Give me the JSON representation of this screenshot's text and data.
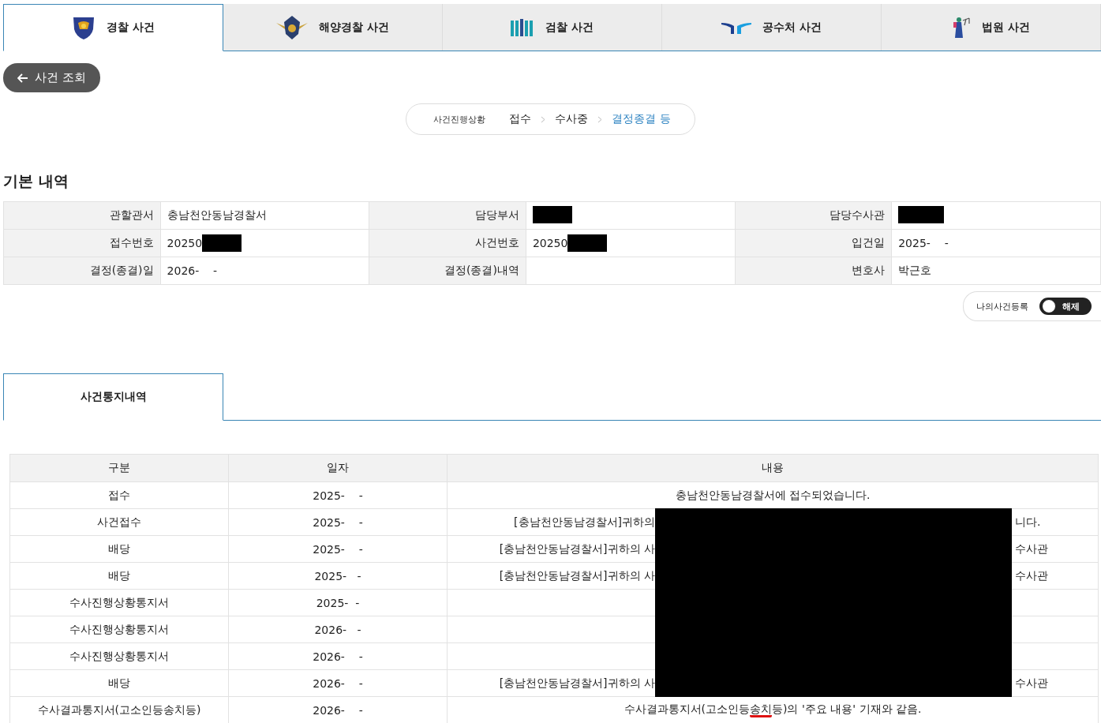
{
  "agency_tabs": [
    {
      "label": "경찰 사건",
      "kind": "police",
      "selected": true
    },
    {
      "label": "해양경찰 사건",
      "kind": "coastguard",
      "selected": false
    },
    {
      "label": "검찰 사건",
      "kind": "prosecution",
      "selected": false
    },
    {
      "label": "공수처 사건",
      "kind": "cio",
      "selected": false
    },
    {
      "label": "법원 사건",
      "kind": "court",
      "selected": false
    }
  ],
  "back_button": {
    "label": "사건 조회"
  },
  "progress": {
    "label": "사건진행상황",
    "steps": [
      {
        "label": "접수",
        "selected": false
      },
      {
        "label": "수사중",
        "selected": false
      },
      {
        "label": "결정종결 등",
        "selected": true
      }
    ]
  },
  "basic_info": {
    "title": "기본 내역",
    "rows": [
      [
        {
          "label": "관할관서",
          "value": "충남천안동남경찰서",
          "redacted": false
        },
        {
          "label": "담당부서",
          "redacted": true
        },
        {
          "label": "담당수사관",
          "redacted": true
        }
      ],
      [
        {
          "label": "접수번호",
          "value": "20250",
          "redacted": true
        },
        {
          "label": "사건번호",
          "value": "20250",
          "redacted": true
        },
        {
          "label": "입건일",
          "value": "2025-    -",
          "redacted": false
        }
      ],
      [
        {
          "label": "결정(종결)일",
          "value": "2026-    -",
          "redacted": false
        },
        {
          "label": "결정(종결)내역",
          "redacted": false
        },
        {
          "label": "변호사",
          "value": "박근호",
          "redacted": false
        }
      ]
    ]
  },
  "my_case": {
    "label": "나의사건등록",
    "switch_label": "해제",
    "on": true
  },
  "notice_tabs": [
    {
      "label": "사건통지내역",
      "selected": true
    }
  ],
  "notice_table": {
    "columns": [
      "구분",
      "일자",
      "내용"
    ],
    "rows": [
      {
        "type": "접수",
        "date": "2025-    -",
        "redacted": false,
        "content": [
          {
            "text": "충남천안동남경찰서에 접수되었습니다.",
            "underlined": false
          }
        ]
      },
      {
        "type": "사건접수",
        "date": "2025-    -",
        "redacted": true,
        "left": "[충남천안동남경찰서]귀하의",
        "right": "니다."
      },
      {
        "type": "배당",
        "date": "2025-    -",
        "redacted": true,
        "left": "[충남천안동남경찰서]귀하의 사",
        "right": "수사관"
      },
      {
        "type": "배당",
        "date": "2025-   -",
        "redacted": true,
        "left": "[충남천안동남경찰서]귀하의 사",
        "right": "수사관"
      },
      {
        "type": "수사진행상황통지서",
        "date": "2025-  -",
        "redacted": true
      },
      {
        "type": "수사진행상황통지서",
        "date": "2026-   -",
        "redacted": true
      },
      {
        "type": "수사진행상황통지서",
        "date": "2026-    -",
        "redacted": true
      },
      {
        "type": "배당",
        "date": "2026-    -",
        "redacted": true,
        "left": "[충남천안동남경찰서]귀하의 사",
        "right": "수사관"
      },
      {
        "type": "수사결과통지서(고소인등송치등)",
        "date": "2026-    -",
        "redacted": false,
        "content": [
          {
            "text": "수사결과통지서(고소인등",
            "underlined": false
          },
          {
            "text": "송치",
            "underlined": true
          },
          {
            "text": "등)의 '주요 내용' 기재와 같음.",
            "underlined": false
          }
        ]
      }
    ]
  }
}
